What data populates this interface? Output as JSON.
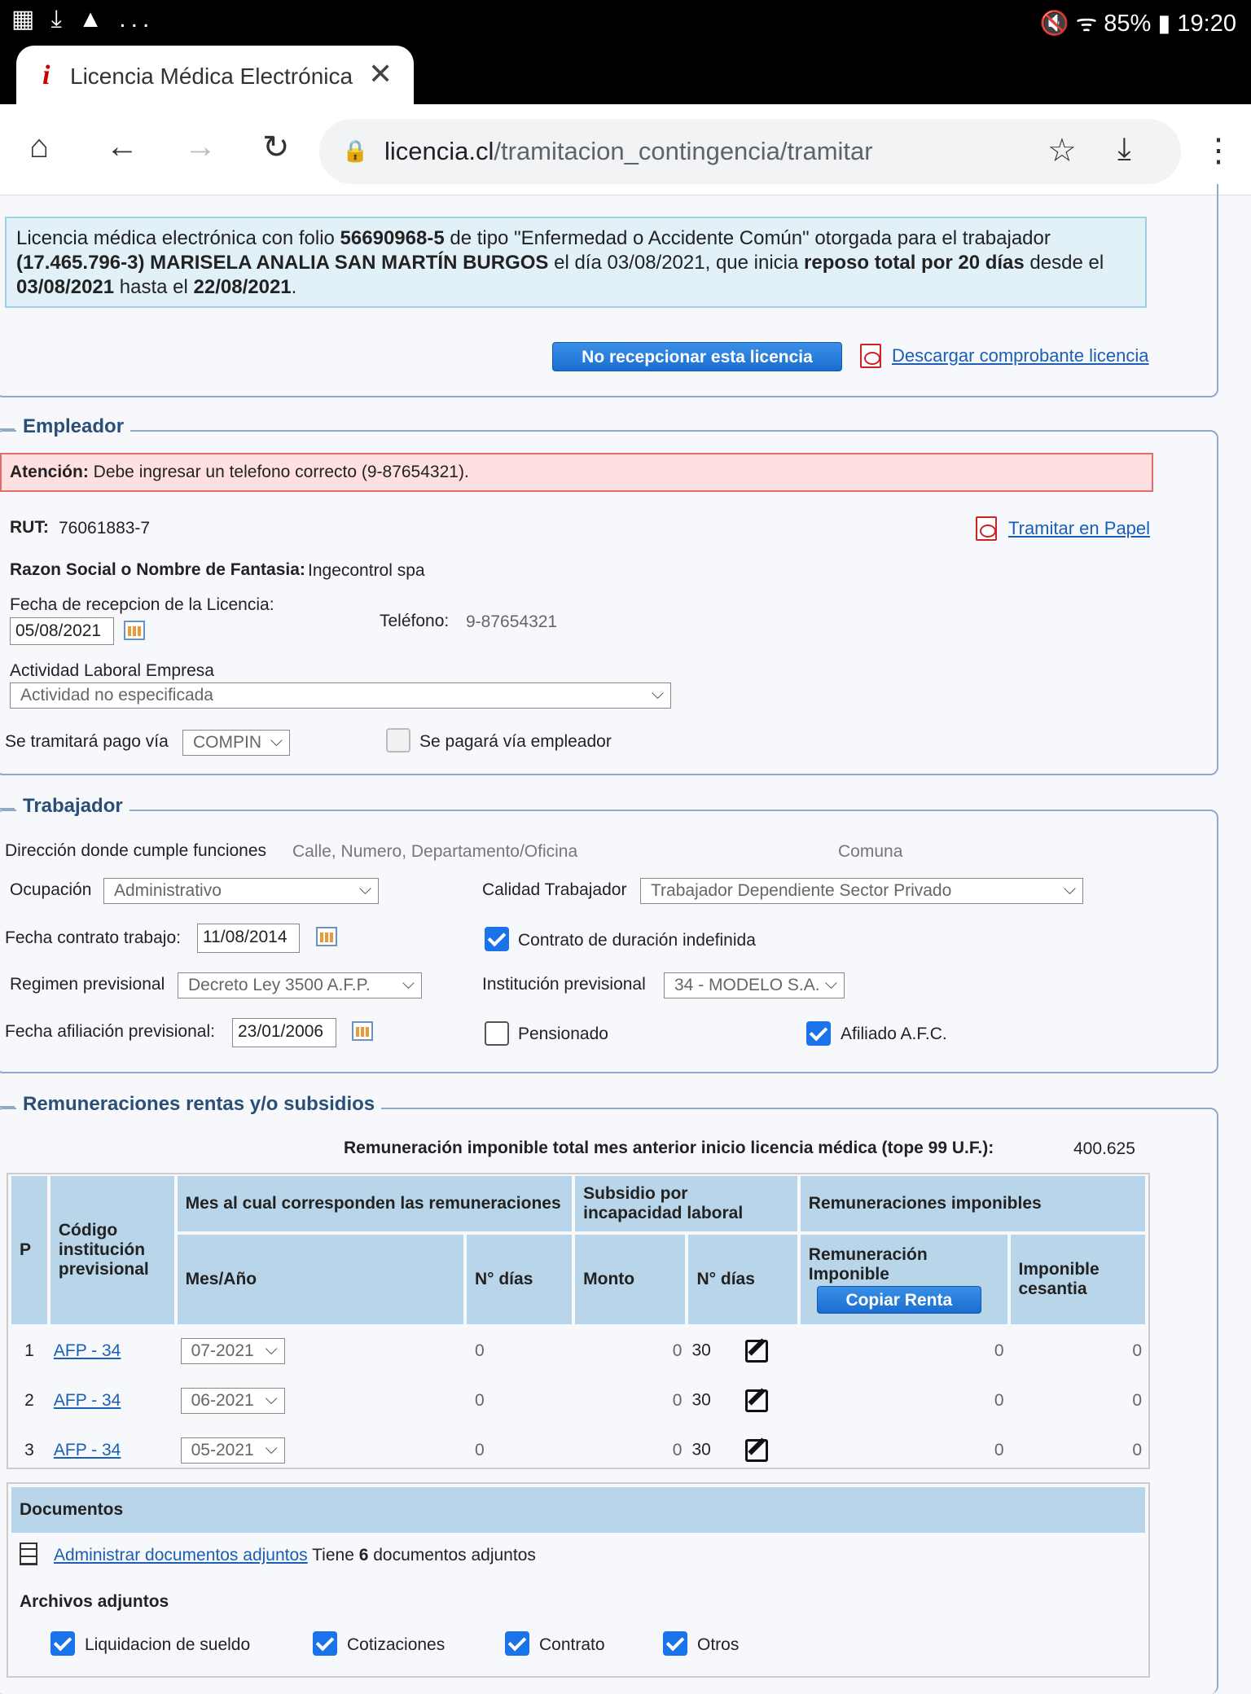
{
  "statusbar": {
    "left_icons": "▦ ⤓ ▲ ...",
    "battery": "85%",
    "time": "19:20"
  },
  "browser": {
    "tab_title": "Licencia Médica Electrónica",
    "tab_favicon": "i",
    "close_glyph": "✕",
    "newtab_glyph": "+",
    "url_domain": "licencia.cl",
    "url_path": "/tramitacion_contingencia/tramitar",
    "home_glyph": "⌂",
    "back_glyph": "←",
    "forward_glyph": "→",
    "reload_glyph": "↻",
    "lock_glyph": "🔒",
    "star_glyph": "☆",
    "download_glyph": "⤓",
    "menu_glyph": "⋮"
  },
  "info": {
    "t1": "Licencia médica electrónica con folio ",
    "folio": "56690968-5",
    "t2": " de tipo \"Enfermedad o Accidente Común\" otorgada para el trabajador ",
    "worker": "(17.465.796-3) MARISELA ANALIA SAN MARTÍN BURGOS",
    "t3": " el día 03/08/2021, que inicia ",
    "reposo": "reposo total por 20 días",
    "t4": " desde el ",
    "desde": "03/08/2021",
    "t5": " hasta el ",
    "hasta": "22/08/2021",
    "t6": "."
  },
  "actions": {
    "no_recepcionar": "No recepcionar esta licencia",
    "descargar": "Descargar comprobante licencia"
  },
  "empleador": {
    "legend": "Empleador",
    "warn_bold": "Atención:",
    "warn_text": " Debe ingresar un telefono correcto (9-87654321).",
    "rut_label": "RUT:",
    "rut_value": "76061883-7",
    "papel_link": "Tramitar en Papel",
    "razon_label": "Razon Social o Nombre de Fantasia:",
    "razon_value": "Ingecontrol spa",
    "fecha_label": "Fecha de recepcion de la Licencia:",
    "fecha_value": "05/08/2021",
    "telefono_label": "Teléfono:",
    "telefono_value": "9-87654321",
    "actividad_label": "Actividad Laboral Empresa",
    "actividad_value": "Actividad no especificada",
    "pago_label": "Se tramitará pago vía",
    "pago_value": "COMPIN",
    "empleador_pago_label": "Se pagará vía empleador"
  },
  "trabajador": {
    "legend": "Trabajador",
    "direccion_label": "Dirección donde cumple funciones",
    "direccion_ph": "Calle, Numero, Departamento/Oficina",
    "comuna_ph": "Comuna",
    "ocupacion_label": "Ocupación",
    "ocupacion_value": "Administrativo",
    "calidad_label": "Calidad Trabajador",
    "calidad_value": "Trabajador Dependiente Sector Privado",
    "contrato_label": "Fecha contrato trabajo:",
    "contrato_value": "11/08/2014",
    "indefinido_label": "Contrato de duración indefinida",
    "regimen_label": "Regimen previsional",
    "regimen_value": "Decreto Ley 3500 A.F.P.",
    "institucion_label": "Institución previsional",
    "institucion_value": "34 - MODELO S.A.",
    "afiliacion_label": "Fecha afiliación previsional:",
    "afiliacion_value": "23/01/2006",
    "pensionado_label": "Pensionado",
    "afc_label": "Afiliado A.F.C."
  },
  "remuneraciones": {
    "legend": "Remuneraciones rentas y/o subsidios",
    "total_label": "Remuneración imponible total mes anterior inicio licencia médica (tope 99 U.F.):",
    "total_value": "400.625",
    "h_p": "P",
    "h_codigo": "Código institución previsional",
    "h_mes": "Mes al cual corresponden las remuneraciones",
    "h_subsidio": "Subsidio por incapacidad laboral",
    "h_remun": "Remuneraciones imponibles",
    "h_mesano": "Mes/Año",
    "h_ndias": "N° días",
    "h_monto": "Monto",
    "h_ndias2": "N° días",
    "h_remimp": "Remuneración Imponible",
    "copiar": "Copiar Renta",
    "h_cesantia": "Imponible cesantia",
    "rows": [
      {
        "p": "1",
        "codigo": "AFP - 34",
        "mes": "07-2021",
        "ndias": "0",
        "monto": "0",
        "ndias2": "30",
        "remimp": "0",
        "cesantia": "0"
      },
      {
        "p": "2",
        "codigo": "AFP - 34",
        "mes": "06-2021",
        "ndias": "0",
        "monto": "0",
        "ndias2": "30",
        "remimp": "0",
        "cesantia": "0"
      },
      {
        "p": "3",
        "codigo": "AFP - 34",
        "mes": "05-2021",
        "ndias": "0",
        "monto": "0",
        "ndias2": "30",
        "remimp": "0",
        "cesantia": "0"
      }
    ]
  },
  "documentos": {
    "title": "Documentos",
    "admin_link": "Administrar documentos adjuntos",
    "tiene": " Tiene ",
    "count": "6",
    "adjuntos": " documentos adjuntos",
    "archivos": "Archivos adjuntos",
    "files": [
      "Liquidacion de sueldo",
      "Cotizaciones",
      "Contrato",
      "Otros"
    ]
  },
  "colors": {
    "accent": "#1a73e8",
    "header_bg": "#b9d5e9",
    "legend": "#2b4e77",
    "info_bg": "#e2f1f8",
    "warn_bg": "#fde0df"
  }
}
